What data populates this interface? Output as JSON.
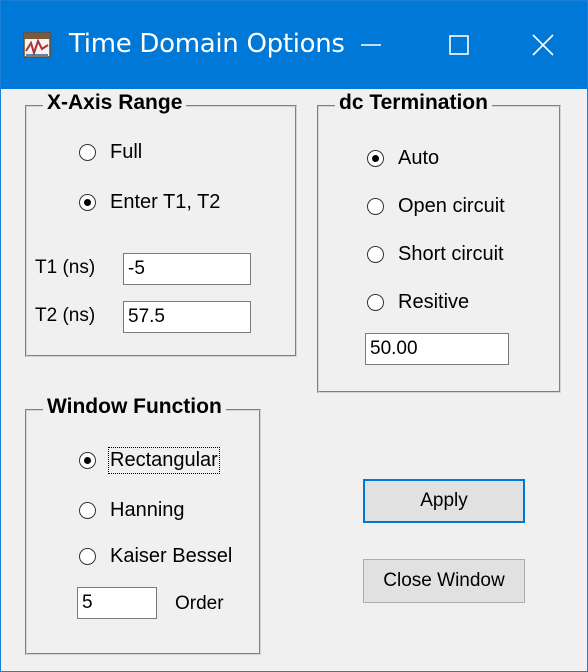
{
  "window": {
    "title": "Time Domain Options",
    "accent_color": "#0078d7",
    "controls": {
      "minimize_icon": "minimize-icon",
      "maximize_icon": "maximize-icon",
      "close_icon": "close-icon"
    }
  },
  "xaxis": {
    "title": "X-Axis Range",
    "options": [
      {
        "label": "Full",
        "checked": false
      },
      {
        "label": "Enter T1, T2",
        "checked": true
      }
    ],
    "t1_label": "T1 (ns)",
    "t1_value": "-5",
    "t2_label": "T2 (ns)",
    "t2_value": "57.5"
  },
  "dc": {
    "title": "dc Termination",
    "options": [
      {
        "label": "Auto",
        "checked": true
      },
      {
        "label": "Open circuit",
        "checked": false
      },
      {
        "label": "Short circuit",
        "checked": false
      },
      {
        "label": "Resitive",
        "checked": false
      }
    ],
    "resistance_value": "50.00"
  },
  "window_function": {
    "title": "Window Function",
    "options": [
      {
        "label": "Rectangular",
        "checked": true
      },
      {
        "label": "Hanning",
        "checked": false
      },
      {
        "label": "Kaiser Bessel",
        "checked": false
      }
    ],
    "order_value": "5",
    "order_label": "Order"
  },
  "buttons": {
    "apply": "Apply",
    "close_window": "Close Window"
  }
}
